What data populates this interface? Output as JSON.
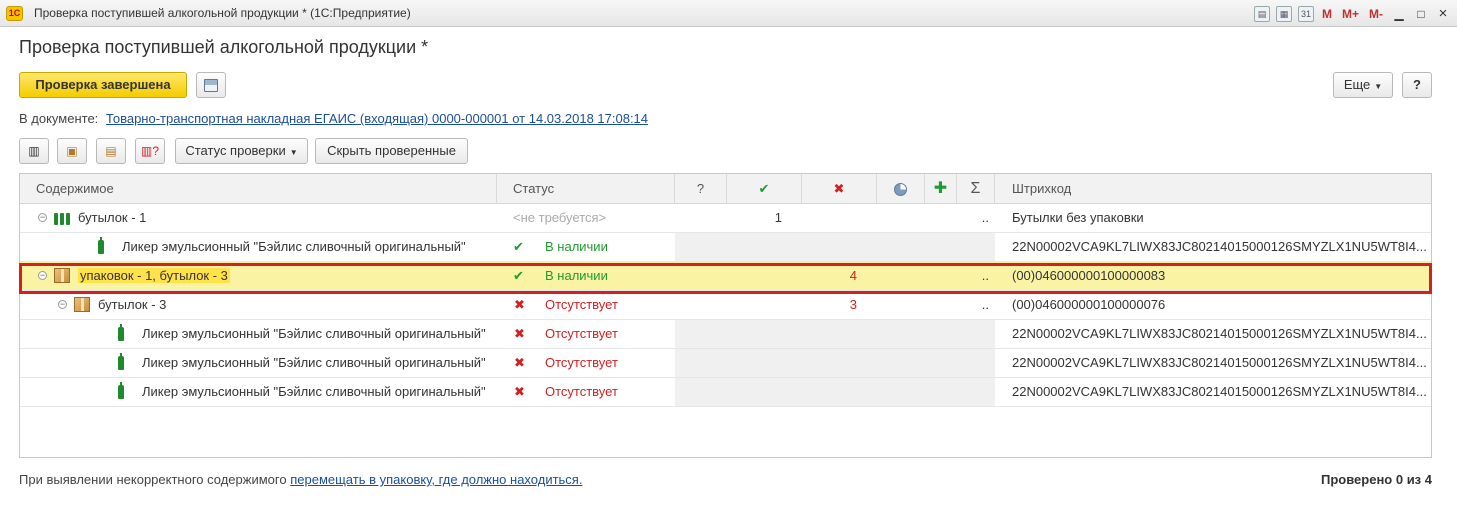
{
  "window": {
    "title": "Проверка поступившей алкогольной продукции * (1С:Предприятие)",
    "app_logo": "1С",
    "controls": [
      "M",
      "M+",
      "M-"
    ]
  },
  "form": {
    "title": "Проверка поступившей алкогольной продукции *",
    "primary_button": "Проверка завершена",
    "more_button": "Еще",
    "help_button": "?",
    "doc_label": "В документе:",
    "doc_link": "Товарно-транспортная накладная ЕГАИС (входящая) 0000-000001 от 14.03.2018 17:08:14",
    "status_button": "Статус проверки",
    "hide_button": "Скрыть проверенные"
  },
  "grid": {
    "headers": {
      "content": "Содержимое",
      "status": "Статус",
      "question": "?",
      "sigma": "Σ",
      "barcode": "Штрихкод"
    },
    "rows": [
      {
        "level": 0,
        "icon": "bottles-icon",
        "label": "бутылок -  1",
        "status": "<не требуется>",
        "status_kind": "na",
        "q": "",
        "ok": "1",
        "bad": "",
        "partial": "",
        "add": "",
        "sum": "..",
        "barcode": "Бутылки без упаковки"
      },
      {
        "level": 1,
        "icon": "bottle-icon",
        "label": "Ликер эмульсионный \"Бэйлис сливочный оригинальный\"",
        "status": "В наличии",
        "status_kind": "ok",
        "q": "",
        "ok": "",
        "bad": "",
        "partial": "",
        "add": "",
        "sum": "",
        "barcode": "22N00002VCA9KL7LIWX83JC80214015000126SMYZLX1NU5WT8I4..."
      },
      {
        "level": 0,
        "icon": "box-icon",
        "label": "упаковок - 1, бутылок -  3",
        "status": "В наличии",
        "status_kind": "ok",
        "q": "",
        "ok": "",
        "bad": "4",
        "partial": "",
        "add": "",
        "sum": "..",
        "barcode": "(00)046000000100000083",
        "selected": true
      },
      {
        "level": 1,
        "icon": "box-icon",
        "label": "бутылок -  3",
        "status": "Отсутствует",
        "status_kind": "bad",
        "q": "",
        "ok": "",
        "bad": "3",
        "partial": "",
        "add": "",
        "sum": "..",
        "barcode": "(00)046000000100000076"
      },
      {
        "level": 2,
        "icon": "bottle-icon",
        "label": "Ликер эмульсионный \"Бэйлис сливочный оригинальный\"",
        "status": "Отсутствует",
        "status_kind": "bad",
        "q": "",
        "ok": "",
        "bad": "",
        "partial": "",
        "add": "",
        "sum": "",
        "barcode": "22N00002VCA9KL7LIWX83JC80214015000126SMYZLX1NU5WT8I4..."
      },
      {
        "level": 2,
        "icon": "bottle-icon",
        "label": "Ликер эмульсионный \"Бэйлис сливочный оригинальный\"",
        "status": "Отсутствует",
        "status_kind": "bad",
        "q": "",
        "ok": "",
        "bad": "",
        "partial": "",
        "add": "",
        "sum": "",
        "barcode": "22N00002VCA9KL7LIWX83JC80214015000126SMYZLX1NU5WT8I4..."
      },
      {
        "level": 2,
        "icon": "bottle-icon",
        "label": "Ликер эмульсионный \"Бэйлис сливочный оригинальный\"",
        "status": "Отсутствует",
        "status_kind": "bad",
        "q": "",
        "ok": "",
        "bad": "",
        "partial": "",
        "add": "",
        "sum": "",
        "barcode": "22N00002VCA9KL7LIWX83JC80214015000126SMYZLX1NU5WT8I4..."
      }
    ]
  },
  "footer": {
    "text": "При выявлении некорректного содержимого",
    "link": "перемещать в упаковку, где должно находиться.",
    "checked": "Проверено 0 из 4"
  },
  "colors": {
    "accent": "#f3cc00",
    "ok": "#1f9c2f",
    "bad": "#d21f1f",
    "link": "#1a4f9c",
    "selection": "#fbf3a4",
    "frame": "#d42020"
  }
}
